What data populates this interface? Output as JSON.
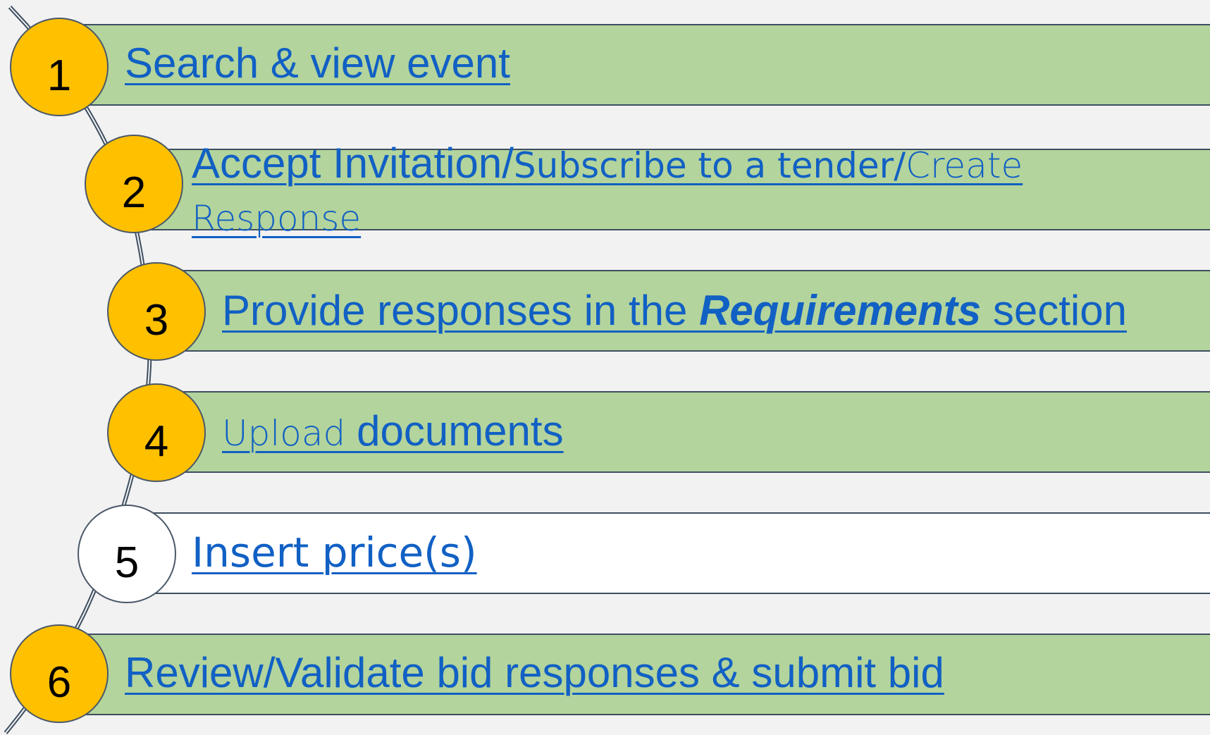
{
  "steps": [
    {
      "number": "1",
      "status": "done",
      "label": "Search & view event"
    },
    {
      "number": "2",
      "status": "done",
      "label_part1": "Accept Invitation/",
      "label_part2": "Subscribe to a tender/",
      "label_part3": "Create",
      "label_line2": "Response"
    },
    {
      "number": "3",
      "status": "done",
      "label_prefix": "Provide responses in the ",
      "label_emphasis": "Requirements",
      "label_suffix": " section"
    },
    {
      "number": "4",
      "status": "done",
      "label_part1": "Upload ",
      "label_part2": "documents"
    },
    {
      "number": "5",
      "status": "current",
      "label": "Insert price(s)"
    },
    {
      "number": "6",
      "status": "done",
      "label": "Review/Validate bid responses & submit bid"
    }
  ],
  "colors": {
    "completed_bar": "#b3d49c",
    "current_bar": "#ffffff",
    "completed_circle": "#ffc000",
    "current_circle": "#ffffff",
    "link_text": "#1160c4",
    "background": "#f2f2f2",
    "outline": "#3d4e60"
  }
}
